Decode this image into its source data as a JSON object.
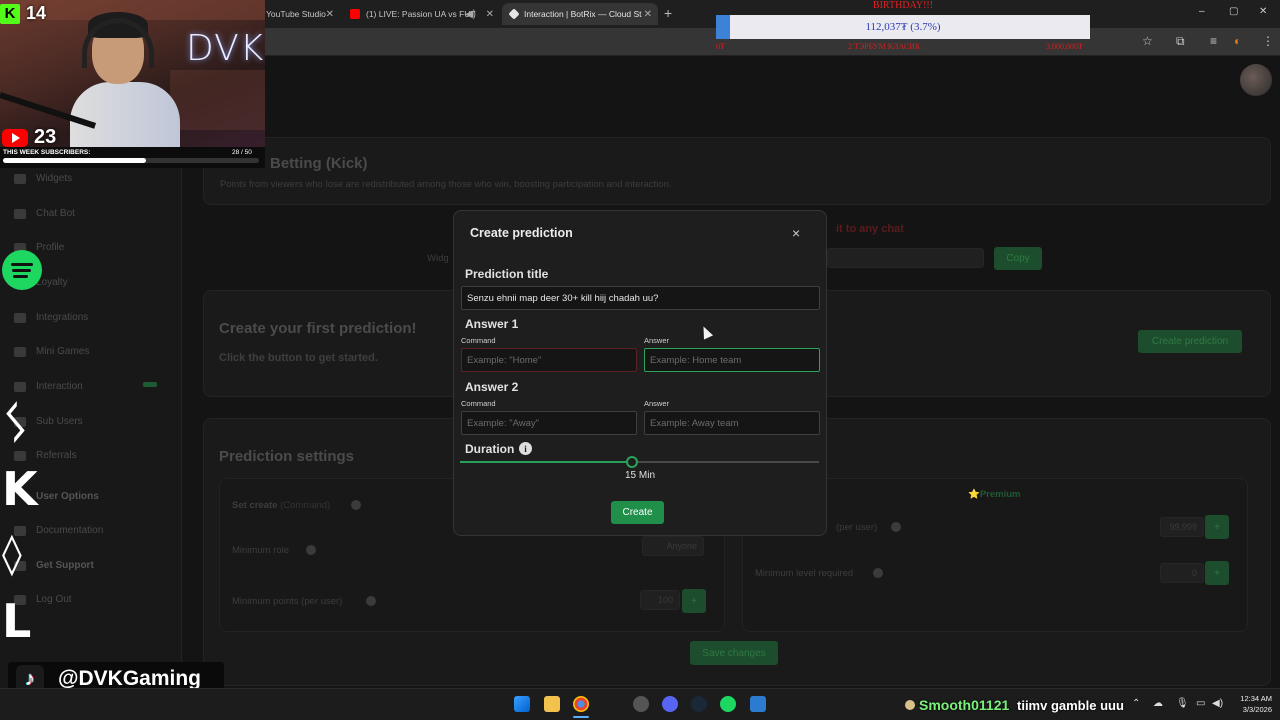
{
  "browser": {
    "tabs": [
      {
        "title": "YouTube Studio"
      },
      {
        "title": "(1) LIVE: Passion UA vs FUT"
      },
      {
        "title": "Interaction | BotRix — Cloud St"
      }
    ],
    "new_tab": "+",
    "window_controls": [
      "–",
      "▢",
      "✕"
    ]
  },
  "goal_overlay": {
    "header": "BIRTHDAY!!!",
    "progress_text": "112,037₮ (3.7%)",
    "progress_fraction": 0.037,
    "start_label": "0₮",
    "middle_label": "2 ТЭРБУМ КЛАСИК",
    "end_label": "3,000,000₮"
  },
  "stream": {
    "kick_count": "14",
    "youtube_count": "23",
    "subs_label": "THIS WEEK SUBSCRIBERS:",
    "subs_count": "28 / 50",
    "subs_fraction": 0.56,
    "neon_text": "DVK",
    "tiktok_handle": "@DVKGaming"
  },
  "page": {
    "section_title": "Points Betting (Kick)",
    "section_desc": "Points from viewers who lose are redistributed among those who win, boosting participation and interaction.",
    "widget_label": "Widg",
    "red_note": "it to any chat",
    "copy_label": "Copy",
    "first_title": "Create your first prediction!",
    "first_desc": "Click the button to get started.",
    "create_prediction_label": "Create prediction",
    "settings_title": "Prediction settings",
    "set_create_label": "Set create",
    "set_create_hint": "(Command)",
    "min_role_label": "Minimum role",
    "min_role_value": "Anyone",
    "min_points_label": "Minimum points (per user)",
    "min_points_value": "100",
    "premium_label": "⭐Premium",
    "max_points_label": "(per user)",
    "max_points_value": "99,999",
    "min_level_label": "Minimum level required",
    "min_level_value": "0",
    "save_label": "Save changes"
  },
  "sidebar": {
    "items": [
      "Widgets",
      "Chat Bot",
      "Profile",
      "Loyalty",
      "Integrations",
      "Mini Games",
      "Interaction",
      "Sub Users",
      "Referrals",
      "User Options",
      "Documentation",
      "Get Support",
      "Log Out"
    ]
  },
  "modal": {
    "title": "Create prediction",
    "close": "×",
    "prediction_title_label": "Prediction title",
    "prediction_title_value": "Senzu ehnii map deer 30+ kill hiij chadah uu?",
    "answer1_label": "Answer 1",
    "answer2_label": "Answer 2",
    "command_label": "Command",
    "answer_label": "Answer",
    "answer1_command_placeholder": "Example: \"Home\"",
    "answer1_answer_placeholder": "Example: Home team",
    "answer2_command_placeholder": "Example: \"Away\"",
    "answer2_answer_placeholder": "Example: Away team",
    "duration_label": "Duration",
    "duration_value": "15 Min",
    "duration_fraction": 0.48,
    "create_label": "Create"
  },
  "taskbar": {
    "chat_user": "Smooth01121",
    "chat_message": "tiimv gamble uuu",
    "time": "12:34 AM",
    "date": "3/3/2026"
  },
  "colors": {
    "accent_green": "#1f8f4a",
    "kick_green": "#53fc18",
    "youtube_red": "#ff0000",
    "spotify_green": "#1ed760"
  }
}
